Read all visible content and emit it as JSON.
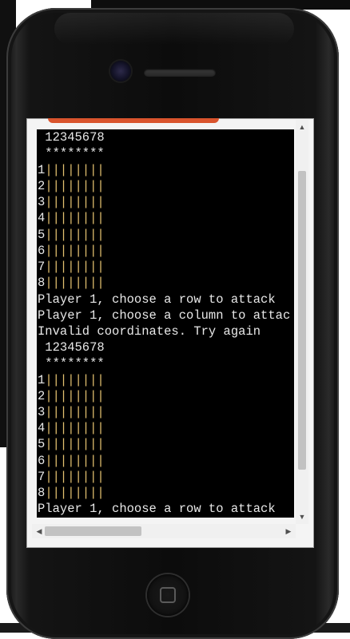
{
  "terminal": {
    "header1": " 12345678",
    "stars1": " ********",
    "board1": [
      {
        "num": "1",
        "cells": "||||||||"
      },
      {
        "num": "2",
        "cells": "||||||||"
      },
      {
        "num": "3",
        "cells": "||||||||"
      },
      {
        "num": "4",
        "cells": "||||||||"
      },
      {
        "num": "5",
        "cells": "||||||||"
      },
      {
        "num": "6",
        "cells": "||||||||"
      },
      {
        "num": "7",
        "cells": "||||||||"
      },
      {
        "num": "8",
        "cells": "||||||||"
      }
    ],
    "prompt_row": "Player 1, choose a row to attack",
    "prompt_col": "Player 1, choose a column to attac",
    "invalid": "Invalid coordinates. Try again",
    "header2": " 12345678",
    "stars2": " ********",
    "board2": [
      {
        "num": "1",
        "cells": "||||||||"
      },
      {
        "num": "2",
        "cells": "||||||||"
      },
      {
        "num": "3",
        "cells": "||||||||"
      },
      {
        "num": "4",
        "cells": "||||||||"
      },
      {
        "num": "5",
        "cells": "||||||||"
      },
      {
        "num": "6",
        "cells": "||||||||"
      },
      {
        "num": "7",
        "cells": "||||||||"
      },
      {
        "num": "8",
        "cells": "||||||||"
      }
    ],
    "prompt_row2": "Player 1, choose a row to attack"
  },
  "colors": {
    "terminal_bg": "#000000",
    "text": "#e8e8e8",
    "board_cells": "#e1bf6f",
    "accent_bar": "#d9542d"
  },
  "icons": {
    "scroll_up": "▲",
    "scroll_down": "▼",
    "scroll_left": "◀",
    "scroll_right": "▶"
  }
}
